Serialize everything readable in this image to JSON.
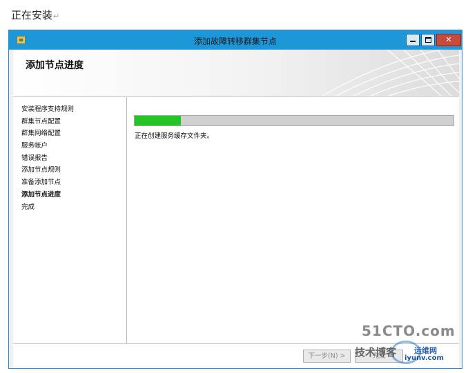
{
  "document": {
    "heading": "正在安装",
    "return_mark": "↵"
  },
  "window": {
    "title": "添加故障转移群集节点",
    "controls": {
      "minimize": "",
      "maximize": "",
      "close": "✕"
    }
  },
  "banner": {
    "page_title": "添加节点进度"
  },
  "sidebar": {
    "steps": [
      {
        "label": "安装程序支持规则",
        "current": false
      },
      {
        "label": "群集节点配置",
        "current": false
      },
      {
        "label": "群集网络配置",
        "current": false
      },
      {
        "label": "服务帐户",
        "current": false
      },
      {
        "label": "错误报告",
        "current": false
      },
      {
        "label": "添加节点规则",
        "current": false
      },
      {
        "label": "准备添加节点",
        "current": false
      },
      {
        "label": "添加节点进度",
        "current": true
      },
      {
        "label": "完成",
        "current": false
      }
    ]
  },
  "progress": {
    "fraction": 0.145,
    "status_text": "正在创建服务缓存文件夹。"
  },
  "footer": {
    "next_label": "下一步(N) >",
    "finish_label": "完成"
  },
  "watermark": {
    "line1": "51CTO.com",
    "line2": "技术博客",
    "line3": "运维网",
    "line4": "iyunv.com"
  },
  "colors": {
    "titlebar": "#1e97d9",
    "progress_fill": "#25c425",
    "progress_track": "#d0d0d0"
  }
}
